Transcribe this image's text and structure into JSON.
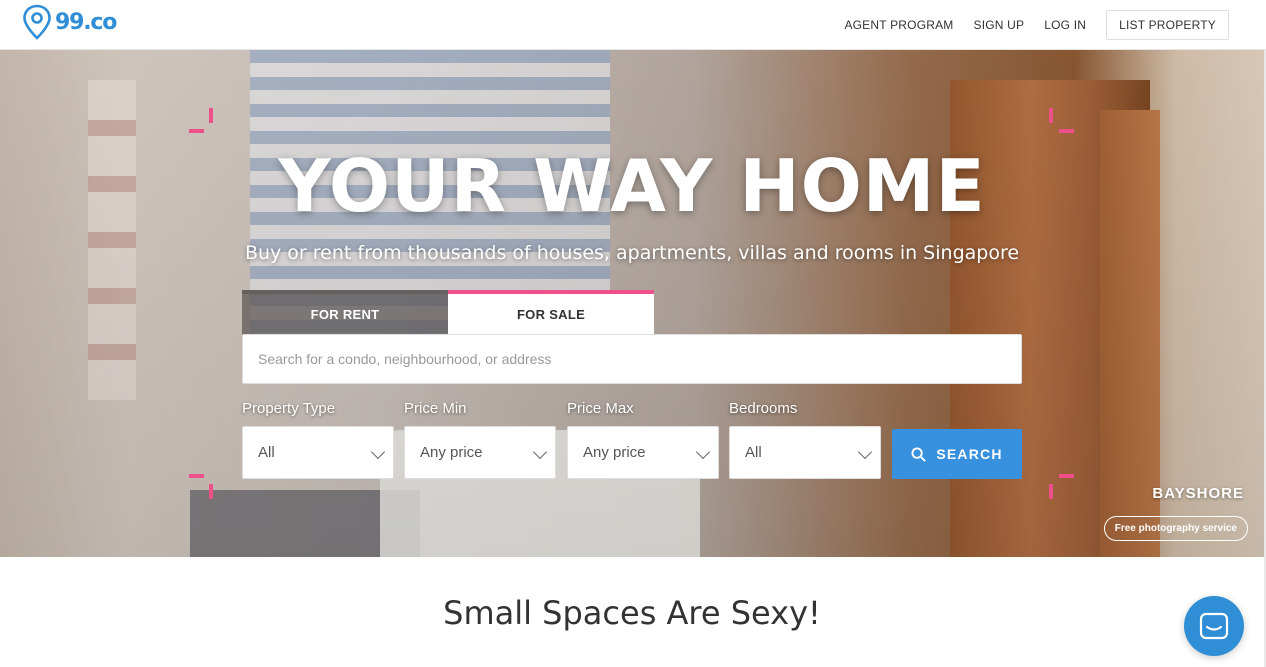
{
  "brand": {
    "name": "99.co",
    "color": "#2f8ed6"
  },
  "nav": {
    "agent_program": "AGENT PROGRAM",
    "sign_up": "SIGN UP",
    "log_in": "LOG IN",
    "list_property": "LIST PROPERTY"
  },
  "hero": {
    "title": "YOUR WAY HOME",
    "subtitle": "Buy or rent from thousands of houses, apartments, villas and rooms in Singapore",
    "accent_color": "#f0508a",
    "tabs": [
      {
        "label": "FOR RENT",
        "active": false
      },
      {
        "label": "FOR SALE",
        "active": true
      }
    ],
    "search": {
      "placeholder": "Search for a condo, neighbourhood, or address",
      "value": ""
    },
    "filters": {
      "property_type": {
        "label": "Property Type",
        "value": "All"
      },
      "price_min": {
        "label": "Price Min",
        "value": "Any price"
      },
      "price_max": {
        "label": "Price Max",
        "value": "Any price"
      },
      "bedrooms": {
        "label": "Bedrooms",
        "value": "All"
      }
    },
    "search_button": "SEARCH",
    "location_caption": "BAYSHORE",
    "photo_service": "Free photography service"
  },
  "section": {
    "title": "Small Spaces Are Sexy!"
  },
  "chat": {
    "icon": "chat-icon"
  }
}
